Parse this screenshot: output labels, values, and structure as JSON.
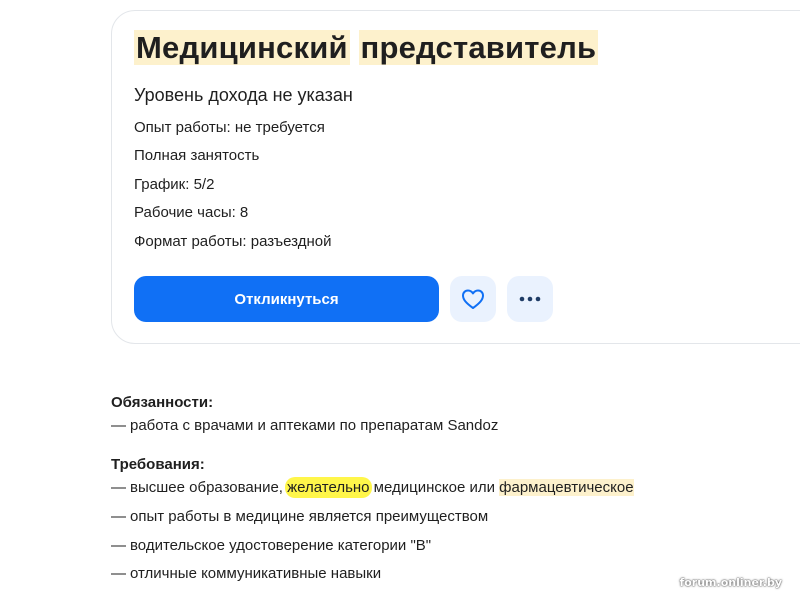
{
  "vacancy": {
    "title_part1": "Медицинский",
    "title_part2": "представитель",
    "salary": "Уровень дохода не указан",
    "facts": [
      "Опыт работы: не требуется",
      "Полная занятость",
      "График: 5/2",
      "Рабочие часы: 8",
      "Формат работы: разъездной"
    ],
    "respond_label": "Откликнуться",
    "favorite_icon": "heart-icon",
    "more_icon": "more-dots-icon"
  },
  "description": {
    "duties_title": "Обязанности:",
    "duties": [
      "работа с врачами и аптеками по препаратам Sandoz"
    ],
    "requirements_title": "Требования:",
    "req1": {
      "before": "высшее образование, ",
      "highlight": "желательно",
      "middle": " медицинское или ",
      "highlight2": "фармацевтическое"
    },
    "requirements": [
      "опыт работы в медицине является преимуществом",
      "водительское удостоверение категории \"В\"",
      "отличные коммуникативные навыки"
    ],
    "dash": "—"
  },
  "watermark": "forum.onliner.by",
  "colors": {
    "primary_button": "#1070f5",
    "icon_button_bg": "#eaf2fe",
    "keyword_highlight": "#fdf1cc",
    "marker_yellow": "#fff64a"
  }
}
